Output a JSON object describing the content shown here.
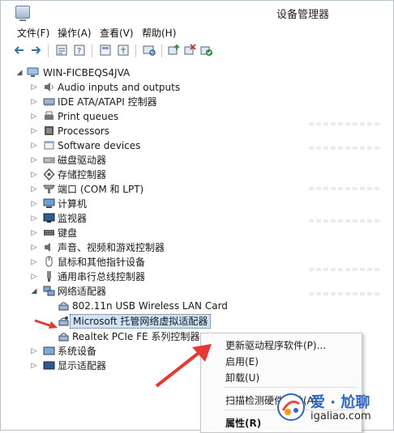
{
  "window": {
    "title": "设备管理器"
  },
  "menu": [
    "文件(F)",
    "操作(A)",
    "查看(V)",
    "帮助(H)"
  ],
  "toolbar": [
    "back-icon",
    "forward-icon",
    "properties-icon",
    "help-icon",
    "show-hidden-icon",
    "scan-hardware-icon",
    "update-driver-icon",
    "uninstall-icon",
    "enable-icon"
  ],
  "tree": {
    "root": "WIN-FICBEQS4JVA",
    "items": [
      {
        "label": "Audio inputs and outputs",
        "icon": "speaker-icon"
      },
      {
        "label": "IDE ATA/ATAPI 控制器",
        "icon": "ide-controller-icon"
      },
      {
        "label": "Print queues",
        "icon": "printer-icon"
      },
      {
        "label": "Processors",
        "icon": "processor-icon"
      },
      {
        "label": "Software devices",
        "icon": "software-device-icon"
      },
      {
        "label": "磁盘驱动器",
        "icon": "disk-icon"
      },
      {
        "label": "存储控制器",
        "icon": "storage-controller-icon"
      },
      {
        "label": "端口 (COM 和 LPT)",
        "icon": "port-icon"
      },
      {
        "label": "计算机",
        "icon": "computer-icon"
      },
      {
        "label": "监视器",
        "icon": "monitor-icon"
      },
      {
        "label": "键盘",
        "icon": "keyboard-icon"
      },
      {
        "label": "声音、视频和游戏控制器",
        "icon": "sound-icon"
      },
      {
        "label": "鼠标和其他指针设备",
        "icon": "mouse-icon"
      },
      {
        "label": "通用串行总线控制器",
        "icon": "usb-icon"
      },
      {
        "label": "网络适配器",
        "icon": "network-adapter-icon"
      },
      {
        "label": "802.11n USB Wireless LAN Card",
        "icon": "network-adapter-icon"
      },
      {
        "label": "Microsoft 托管网络虚拟适配器",
        "icon": "network-adapter-icon"
      },
      {
        "label": "Realtek PCIe FE 系列控制器",
        "icon": "network-adapter-icon"
      },
      {
        "label": "系统设备",
        "icon": "system-device-icon"
      },
      {
        "label": "显示适配器",
        "icon": "display-adapter-icon"
      }
    ]
  },
  "context_menu": [
    "更新驱动程序软件(P)...",
    "启用(E)",
    "卸载(U)",
    "扫描检测硬件改动(A)",
    "属性(R)"
  ],
  "watermark": {
    "title": "爱 · 尬聊",
    "url": "igaliao.com"
  },
  "colors": {
    "selection": "#cfe3fb",
    "annotation": "#e53935",
    "brand": "#2f66c9"
  }
}
